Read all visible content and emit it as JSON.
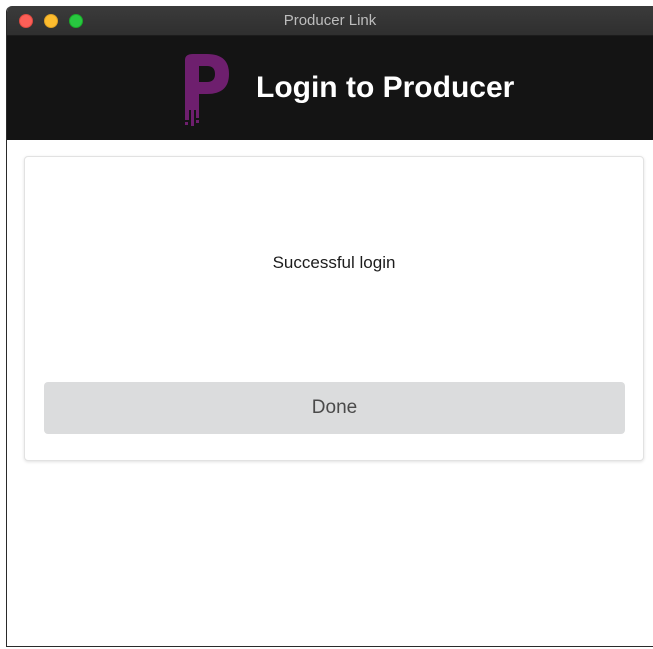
{
  "window": {
    "title": "Producer Link",
    "controls": {
      "close": "close-button",
      "minimize": "minimize-button",
      "zoom": "zoom-button"
    }
  },
  "header": {
    "logo_icon": "producer-p-logo-icon",
    "title": "Login to Producer"
  },
  "card": {
    "message": "Successful login",
    "done_label": "Done"
  },
  "colors": {
    "header_background": "#141414",
    "logo_purple": "#6e1f6e",
    "button_background": "#dbdcdd",
    "traffic_close": "#fc5f57",
    "traffic_minimize": "#fdbc2e",
    "traffic_zoom": "#28c840"
  }
}
